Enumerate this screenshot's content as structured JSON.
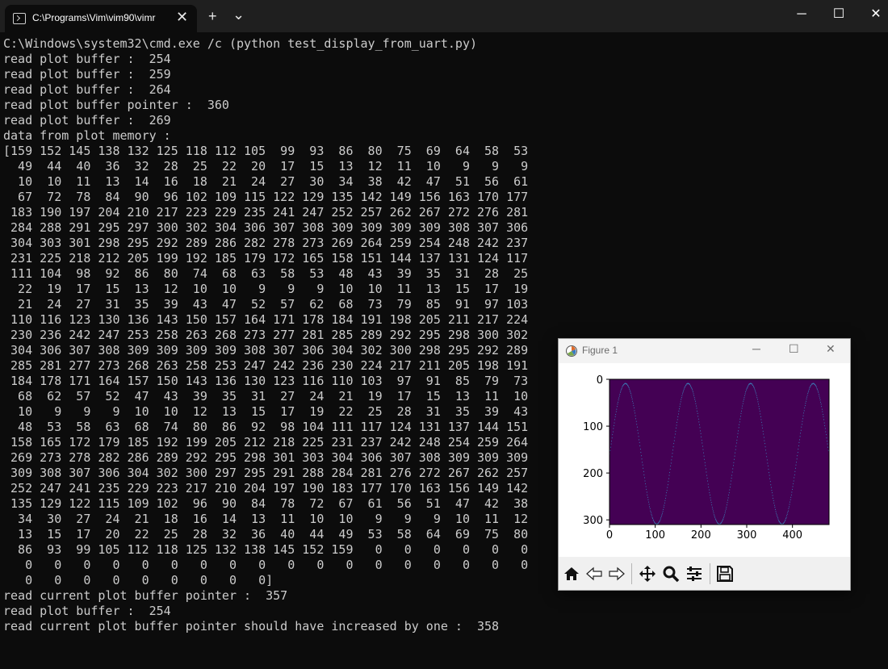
{
  "window": {
    "tab_title": "C:\\Programs\\Vim\\vim90\\vimr",
    "tab_close": "✕",
    "new_tab": "+",
    "dropdown": "⌄",
    "minimize": "─",
    "maximize": "☐",
    "close": "✕"
  },
  "console": {
    "lines": [
      "C:\\Windows\\system32\\cmd.exe /c (python test_display_from_uart.py)",
      "read plot buffer :  254",
      "read plot buffer :  259",
      "read plot buffer :  264",
      "read plot buffer pointer :  360",
      "read plot buffer :  269",
      "data from plot memory :",
      "[159 152 145 138 132 125 118 112 105  99  93  86  80  75  69  64  58  53",
      "  49  44  40  36  32  28  25  22  20  17  15  13  12  11  10   9   9   9",
      "  10  10  11  13  14  16  18  21  24  27  30  34  38  42  47  51  56  61",
      "  67  72  78  84  90  96 102 109 115 122 129 135 142 149 156 163 170 177",
      " 183 190 197 204 210 217 223 229 235 241 247 252 257 262 267 272 276 281",
      " 284 288 291 295 297 300 302 304 306 307 308 309 309 309 309 308 307 306",
      " 304 303 301 298 295 292 289 286 282 278 273 269 264 259 254 248 242 237",
      " 231 225 218 212 205 199 192 185 179 172 165 158 151 144 137 131 124 117",
      " 111 104  98  92  86  80  74  68  63  58  53  48  43  39  35  31  28  25",
      "  22  19  17  15  13  12  10  10   9   9   9  10  10  11  13  15  17  19",
      "  21  24  27  31  35  39  43  47  52  57  62  68  73  79  85  91  97 103",
      " 110 116 123 130 136 143 150 157 164 171 178 184 191 198 205 211 217 224",
      " 230 236 242 247 253 258 263 268 273 277 281 285 289 292 295 298 300 302",
      " 304 306 307 308 309 309 309 309 308 307 306 304 302 300 298 295 292 289",
      " 285 281 277 273 268 263 258 253 247 242 236 230 224 217 211 205 198 191",
      " 184 178 171 164 157 150 143 136 130 123 116 110 103  97  91  85  79  73",
      "  68  62  57  52  47  43  39  35  31  27  24  21  19  17  15  13  11  10",
      "  10   9   9   9  10  10  12  13  15  17  19  22  25  28  31  35  39  43",
      "  48  53  58  63  68  74  80  86  92  98 104 111 117 124 131 137 144 151",
      " 158 165 172 179 185 192 199 205 212 218 225 231 237 242 248 254 259 264",
      " 269 273 278 282 286 289 292 295 298 301 303 304 306 307 308 309 309 309",
      " 309 308 307 306 304 302 300 297 295 291 288 284 281 276 272 267 262 257",
      " 252 247 241 235 229 223 217 210 204 197 190 183 177 170 163 156 149 142",
      " 135 129 122 115 109 102  96  90  84  78  72  67  61  56  51  47  42  38",
      "  34  30  27  24  21  18  16  14  13  11  10  10   9   9   9  10  11  12",
      "  13  15  17  20  22  25  28  32  36  40  44  49  53  58  64  69  75  80",
      "  86  93  99 105 112 118 125 132 138 145 152 159   0   0   0   0   0   0",
      "   0   0   0   0   0   0   0   0   0   0   0   0   0   0   0   0   0   0",
      "   0   0   0   0   0   0   0   0   0]",
      "read current plot buffer pointer :  357",
      "read plot buffer :  254",
      "read current plot buffer pointer should have increased by one :  358"
    ]
  },
  "figure": {
    "title": "Figure 1",
    "minimize": "─",
    "maximize": "☐",
    "close": "✕",
    "colors": {
      "background": "#440154",
      "trace": "#3b8bc2"
    },
    "tools": [
      "home-icon",
      "back-arrow-icon",
      "forward-arrow-icon",
      "pan-move-icon",
      "zoom-magnifier-icon",
      "configure-subplots-icon",
      "save-disk-icon"
    ]
  },
  "chart_data": {
    "type": "heatmap",
    "title": "",
    "xlabel": "",
    "ylabel": "",
    "xlim": [
      0,
      480
    ],
    "ylim": [
      310,
      0
    ],
    "x_ticks": [
      "0",
      "100",
      "200",
      "300",
      "400"
    ],
    "y_ticks": [
      "0",
      "100",
      "200",
      "300"
    ],
    "series": [
      {
        "values": [
          159,
          152,
          145,
          138,
          132,
          125,
          118,
          112,
          105,
          99,
          93,
          86,
          80,
          75,
          69,
          64,
          58,
          53,
          49,
          44,
          40,
          36,
          32,
          28,
          25,
          22,
          20,
          17,
          15,
          13,
          12,
          11,
          10,
          9,
          9,
          9,
          10,
          10,
          11,
          13,
          14,
          16,
          18,
          21,
          24,
          27,
          30,
          34,
          38,
          42,
          47,
          51,
          56,
          61,
          67,
          72,
          78,
          84,
          90,
          96,
          102,
          109,
          115,
          122,
          129,
          135,
          142,
          149,
          156,
          163,
          170,
          177,
          183,
          190,
          197,
          204,
          210,
          217,
          223,
          229,
          235,
          241,
          247,
          252,
          257,
          262,
          267,
          272,
          276,
          281,
          284,
          288,
          291,
          295,
          297,
          300,
          302,
          304,
          306,
          307,
          308,
          309,
          309,
          309,
          309,
          308,
          307,
          306,
          304,
          303,
          301,
          298,
          295,
          292,
          289,
          286,
          282,
          278,
          273,
          269,
          264,
          259,
          254,
          248,
          242,
          237,
          231,
          225,
          218,
          212,
          205,
          199,
          192,
          185,
          179,
          172,
          165,
          158,
          151,
          144,
          137,
          131,
          124,
          117,
          111,
          104,
          98,
          92,
          86,
          80,
          74,
          68,
          63,
          58,
          53,
          48,
          43,
          39,
          35,
          31,
          28,
          25,
          22,
          19,
          17,
          15,
          13,
          12,
          10,
          10,
          9,
          9,
          9,
          10,
          10,
          11,
          13,
          15,
          17,
          19,
          21,
          24,
          27,
          31,
          35,
          39,
          43,
          47,
          52,
          57,
          62,
          68,
          73,
          79,
          85,
          91,
          97,
          103,
          110,
          116,
          123,
          130,
          136,
          143,
          150,
          157,
          164,
          171,
          178,
          184,
          191,
          198,
          205,
          211,
          217,
          224,
          230,
          236,
          242,
          247,
          253,
          258,
          263,
          268,
          273,
          277,
          281,
          285,
          289,
          292,
          295,
          298,
          300,
          302,
          304,
          306,
          307,
          308,
          309,
          309,
          309,
          309,
          308,
          307,
          306,
          304,
          302,
          300,
          298,
          295,
          292,
          289,
          285,
          281,
          277,
          273,
          268,
          263,
          258,
          253,
          247,
          242,
          236,
          230,
          224,
          217,
          211,
          205,
          198,
          191,
          184,
          178,
          171,
          164,
          157,
          150,
          143,
          136,
          130,
          123,
          116,
          110,
          103,
          97,
          91,
          85,
          79,
          73,
          68,
          62,
          57,
          52,
          47,
          43,
          39,
          35,
          31,
          27,
          24,
          21,
          19,
          17,
          15,
          13,
          11,
          10,
          10,
          9,
          9,
          9,
          10,
          10,
          12,
          13,
          15,
          17,
          19,
          22,
          25,
          28,
          31,
          35,
          39,
          43,
          48,
          53,
          58,
          63,
          68,
          74,
          80,
          86,
          92,
          98,
          104,
          111,
          117,
          124,
          131,
          137,
          144,
          151,
          158,
          165,
          172,
          179,
          185,
          192,
          199,
          205,
          212,
          218,
          225,
          231,
          237,
          242,
          248,
          254,
          259,
          264,
          269,
          273,
          278,
          282,
          286,
          289,
          292,
          295,
          298,
          301,
          303,
          304,
          306,
          307,
          308,
          309,
          309,
          309,
          309,
          308,
          307,
          306,
          304,
          302,
          300,
          297,
          295,
          291,
          288,
          284,
          281,
          276,
          272,
          267,
          262,
          257,
          252,
          247,
          241,
          235,
          229,
          223,
          217,
          210,
          204,
          197,
          190,
          183,
          177,
          170,
          163,
          156,
          149,
          142,
          135,
          129,
          122,
          115,
          109,
          102,
          96,
          90,
          84,
          78,
          72,
          67,
          61,
          56,
          51,
          47,
          42,
          38,
          34,
          30,
          27,
          24,
          21,
          18,
          16,
          14,
          13,
          11,
          10,
          10,
          9,
          9,
          9,
          10,
          11,
          12,
          13,
          15,
          17,
          20,
          22,
          25,
          28,
          32,
          36,
          40,
          44,
          49,
          53,
          58,
          64,
          69,
          75,
          80,
          86,
          93,
          99,
          105,
          112,
          118,
          125,
          132,
          138,
          145,
          152,
          159
        ]
      }
    ]
  }
}
